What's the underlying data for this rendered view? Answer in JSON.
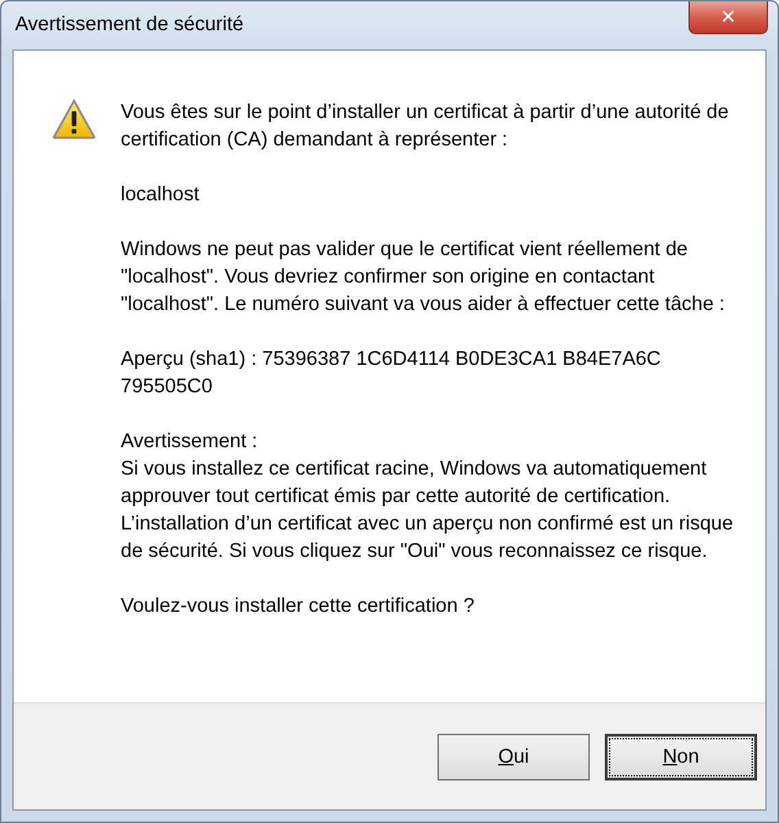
{
  "window": {
    "title": "Avertissement de sécurité",
    "close_glyph": "✕"
  },
  "message": [
    {
      "kind": "text",
      "text": "Vous êtes sur le point d’installer un certificat à partir d’une autorité de certification (CA) demandant à représenter :"
    },
    {
      "kind": "text",
      "text": "localhost"
    },
    {
      "kind": "text",
      "text": "Windows ne peut pas valider que le certificat vient réellement de \"localhost\". Vous devriez confirmer son origine en contactant \"localhost\". Le numéro suivant va vous aider à effectuer cette tâche :"
    },
    {
      "kind": "text",
      "text": "Aperçu (sha1) : 75396387 1C6D4114 B0DE3CA1 B84E7A6C 795505C0"
    },
    {
      "kind": "titled",
      "heading": "Avertissement :",
      "text": "Si vous installez ce certificat racine, Windows va automatiquement approuver tout certificat émis par cette autorité de certification. L’installation d’un certificat avec un aperçu non confirmé est un risque de sécurité. Si vous cliquez sur \"Oui\" vous reconnaissez ce risque."
    },
    {
      "kind": "text",
      "text": "Voulez-vous installer cette certification ?"
    }
  ],
  "buttons": [
    {
      "access_key": "O",
      "rest": "ui",
      "focused": false
    },
    {
      "access_key": "N",
      "rest": "on",
      "focused": true
    }
  ]
}
